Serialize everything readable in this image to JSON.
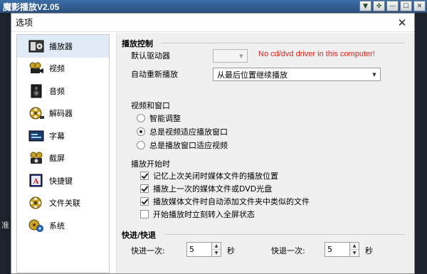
{
  "player": {
    "title": "魔影播放V2.05",
    "status_text": "准"
  },
  "dialog": {
    "title": "选项",
    "close_glyph": "✕"
  },
  "sidebar": {
    "items": [
      {
        "label": "播放器",
        "icon": "player-icon"
      },
      {
        "label": "视频",
        "icon": "film-camera-icon"
      },
      {
        "label": "音频",
        "icon": "speaker-icon"
      },
      {
        "label": "解码器",
        "icon": "film-reel-icon"
      },
      {
        "label": "字幕",
        "icon": "subtitle-icon"
      },
      {
        "label": "截屏",
        "icon": "capture-icon"
      },
      {
        "label": "快捷键",
        "icon": "hotkey-icon"
      },
      {
        "label": "文件关联",
        "icon": "file-assoc-icon"
      },
      {
        "label": "系统",
        "icon": "system-icon"
      }
    ]
  },
  "playback": {
    "heading": "播放控制",
    "default_drive_label": "默认驱动器",
    "default_drive_value": "",
    "no_drive_msg": "No cd/dvd driver in this computer!",
    "auto_replay_label": "自动重新播放",
    "auto_replay_value": "从最后位置继续播放"
  },
  "video_window": {
    "heading": "视频和窗口",
    "options": [
      "智能调整",
      "总是视频适应播放窗口",
      "总是播放窗口适应视频"
    ],
    "selected_index": 1
  },
  "on_start": {
    "heading": "播放开始时",
    "options": [
      {
        "label": "记忆上次关闭时媒体文件的播放位置",
        "checked": true
      },
      {
        "label": "播放上一次的媒体文件或DVD光盘",
        "checked": true
      },
      {
        "label": "播放媒体文件时自动添加文件夹中类似的文件",
        "checked": true
      },
      {
        "label": "开始播放时立刻转入全屏状态",
        "checked": false
      }
    ]
  },
  "seek": {
    "heading": "快进/快退",
    "forward_label": "快进一次:",
    "forward_value": "5",
    "backward_label": "快退一次:",
    "backward_value": "5",
    "unit": "秒"
  }
}
